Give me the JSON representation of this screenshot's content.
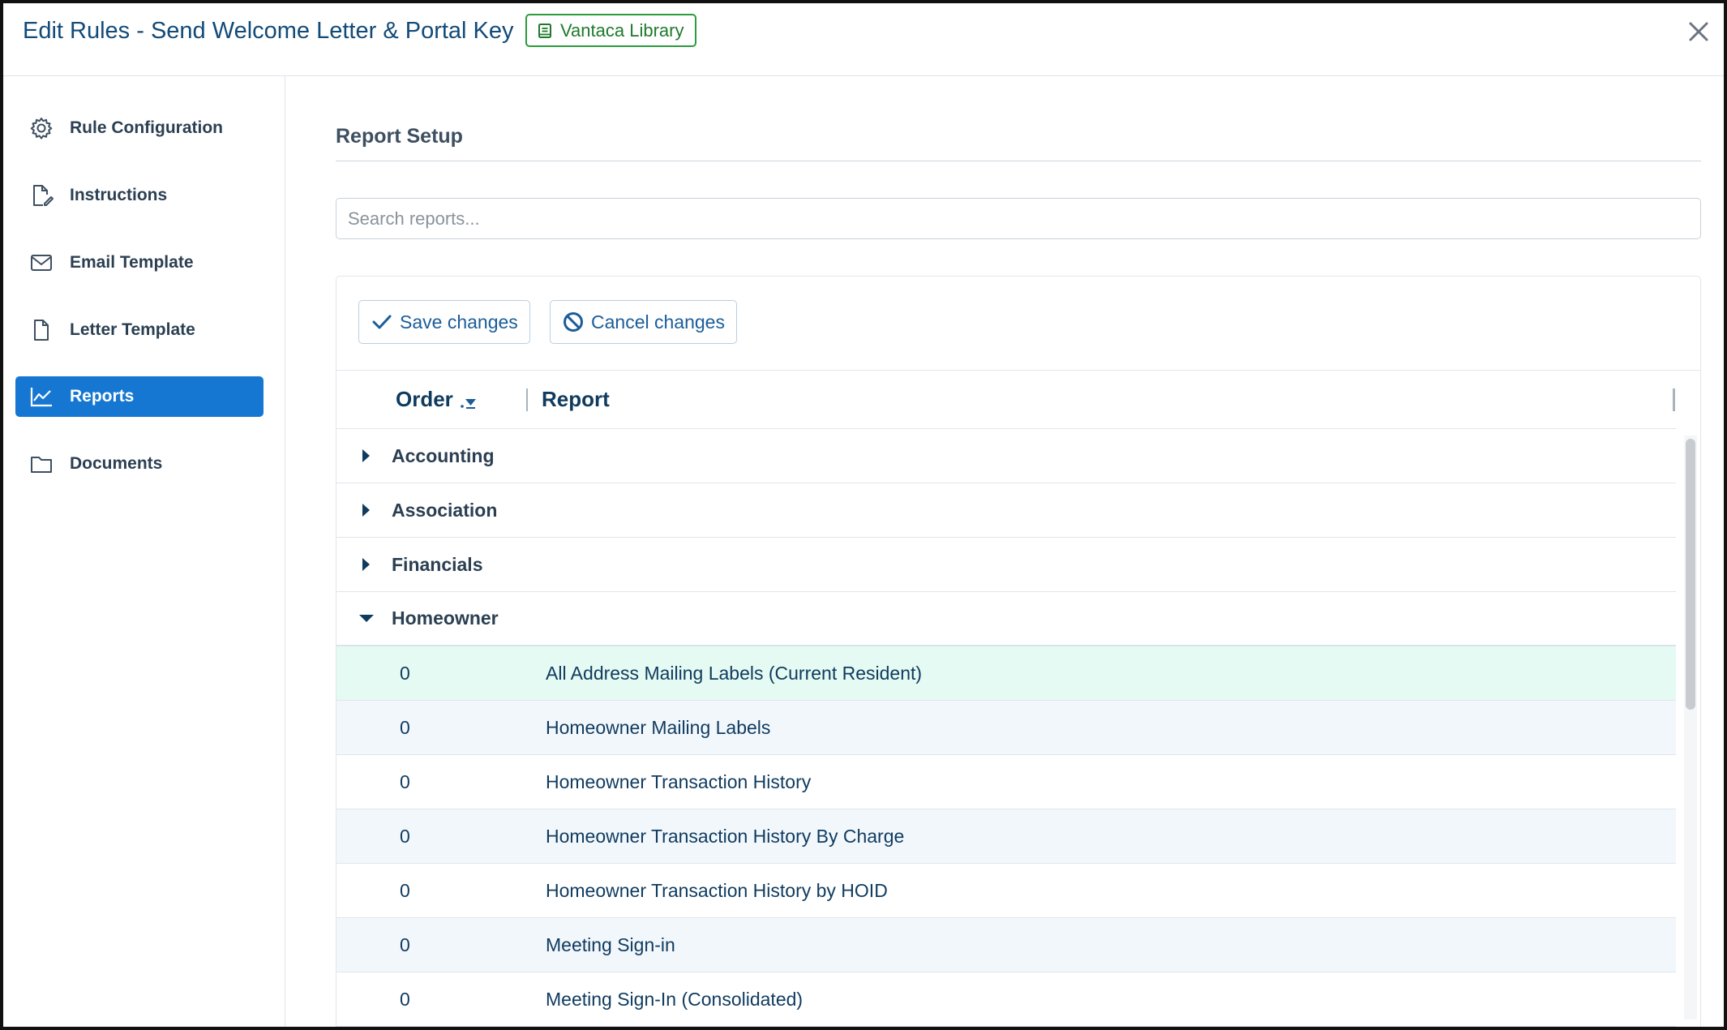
{
  "header": {
    "title": "Edit Rules - Send Welcome Letter & Portal Key",
    "badge": "Vantaca Library",
    "close_icon": "close-icon"
  },
  "sidebar": {
    "items": [
      {
        "label": "Rule Configuration",
        "icon": "gear-icon",
        "active": false
      },
      {
        "label": "Instructions",
        "icon": "document-edit-icon",
        "active": false
      },
      {
        "label": "Email Template",
        "icon": "envelope-icon",
        "active": false
      },
      {
        "label": "Letter Template",
        "icon": "document-icon",
        "active": false
      },
      {
        "label": "Reports",
        "icon": "line-chart-icon",
        "active": true
      },
      {
        "label": "Documents",
        "icon": "folder-icon",
        "active": false
      }
    ]
  },
  "main": {
    "section_title": "Report Setup",
    "search": {
      "placeholder": "Search reports...",
      "value": ""
    },
    "toolbar": {
      "save_label": "Save changes",
      "cancel_label": "Cancel changes"
    },
    "columns": {
      "order": "Order",
      "report": "Report"
    },
    "groups": [
      {
        "label": "Accounting",
        "expanded": false
      },
      {
        "label": "Association",
        "expanded": false
      },
      {
        "label": "Financials",
        "expanded": false
      },
      {
        "label": "Homeowner",
        "expanded": true
      }
    ],
    "rows": [
      {
        "order": "0",
        "report": "All Address Mailing Labels (Current Resident)"
      },
      {
        "order": "0",
        "report": "Homeowner Mailing Labels"
      },
      {
        "order": "0",
        "report": "Homeowner Transaction History"
      },
      {
        "order": "0",
        "report": "Homeowner Transaction History By Charge"
      },
      {
        "order": "0",
        "report": "Homeowner Transaction History by HOID"
      },
      {
        "order": "0",
        "report": "Meeting Sign-in"
      },
      {
        "order": "0",
        "report": "Meeting Sign-In (Consolidated)"
      }
    ]
  },
  "colors": {
    "accent": "#1677d2",
    "title": "#124a78",
    "badge_green": "#2c9a3e",
    "selected_row": "#e5faf2",
    "alt_row": "#f2f7fc"
  }
}
